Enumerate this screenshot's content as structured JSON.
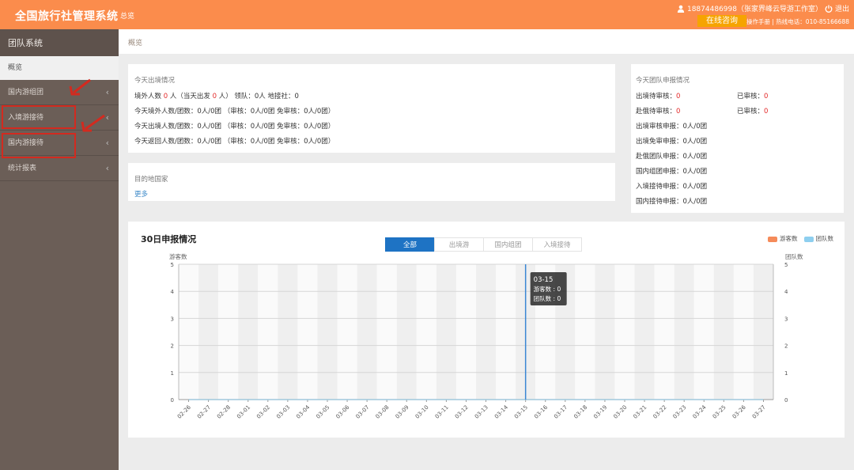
{
  "header": {
    "app_title": "全国旅行社管理系统",
    "nav": "总览",
    "user": "18874486998（张家界峰云导游工作室）",
    "logout": "退出",
    "consult": "在线咨询",
    "hotline": "操作手册 | 热线电话：010-85166688",
    "colors": {
      "topbar": "#fb8c4c",
      "consult": "#f6a400"
    }
  },
  "sidebar": {
    "title": "团队系统",
    "overview": "概览",
    "items": [
      {
        "label": "国内游组团",
        "icon": "chevron-left-icon"
      },
      {
        "label": "入境游接待",
        "icon": "chevron-left-icon"
      },
      {
        "label": "国内游接待",
        "icon": "chevron-left-icon"
      },
      {
        "label": "统计报表",
        "icon": "chevron-left-icon"
      }
    ]
  },
  "breadcrumb": "概览",
  "today_exit": {
    "title": "今天出境情况",
    "l1_a": "境外人数",
    "l1_v1": "0",
    "l1_b": "人（当天出发",
    "l1_v2": "0",
    "l1_c": "人） 领队：0人 地接社：0",
    "l2": "今天境外人数/团数：0人/0团 （审核：0人/0团 免审核：0人/0团）",
    "l3": "今天出境人数/团数：0人/0团 （审核：0人/0团 免审核：0人/0团）",
    "l4": "今天返回人数/团数：0人/0团 （审核：0人/0团 免审核：0人/0团）"
  },
  "destination": {
    "title": "目的地国家",
    "more": "更多"
  },
  "today_report": {
    "title": "今天团队申报情况",
    "rows": [
      {
        "left_label": "出境待审核：",
        "left_value": "0",
        "right_label": "已审核：",
        "right_value": "0"
      },
      {
        "left_label": "赴俄待审核：",
        "left_value": "0",
        "right_label": "已审核：",
        "right_value": "0"
      }
    ],
    "lines": [
      "出境审核申报：0人/0团",
      "出境免审申报：0人/0团",
      "赴俄团队申报：0人/0团",
      "国内组团申报：0人/0团",
      "入境接待申报：0人/0团",
      "国内接待申报：0人/0团"
    ]
  },
  "chart_section": {
    "title": "30日申报情况",
    "tabs": [
      "全部",
      "出境游",
      "国内组团",
      "入境接待"
    ],
    "active_tab": 0,
    "tooltip": {
      "date": "03-15",
      "tourists": "游客数 : 0",
      "teams": "团队数 : 0"
    }
  },
  "chart_data": {
    "type": "line",
    "categories": [
      "02-26",
      "02-27",
      "02-28",
      "03-01",
      "03-02",
      "03-03",
      "03-04",
      "03-05",
      "03-06",
      "03-07",
      "03-08",
      "03-09",
      "03-10",
      "03-11",
      "03-12",
      "03-13",
      "03-14",
      "03-15",
      "03-16",
      "03-17",
      "03-18",
      "03-19",
      "03-20",
      "03-21",
      "03-22",
      "03-23",
      "03-24",
      "03-25",
      "03-26",
      "03-27"
    ],
    "series": [
      {
        "name": "游客数",
        "color": "#f58b5a",
        "values": [
          0,
          0,
          0,
          0,
          0,
          0,
          0,
          0,
          0,
          0,
          0,
          0,
          0,
          0,
          0,
          0,
          0,
          0,
          0,
          0,
          0,
          0,
          0,
          0,
          0,
          0,
          0,
          0,
          0,
          0
        ]
      },
      {
        "name": "团队数",
        "color": "#8ecfef",
        "values": [
          0,
          0,
          0,
          0,
          0,
          0,
          0,
          0,
          0,
          0,
          0,
          0,
          0,
          0,
          0,
          0,
          0,
          0,
          0,
          0,
          0,
          0,
          0,
          0,
          0,
          0,
          0,
          0,
          0,
          0
        ]
      }
    ],
    "ylabel_left": "游客数",
    "ylabel_right": "团队数",
    "yticks": [
      0,
      1,
      2,
      3,
      4,
      5
    ],
    "ylim": [
      0,
      5
    ],
    "highlight": "03-15",
    "legend_position": "top-right"
  }
}
